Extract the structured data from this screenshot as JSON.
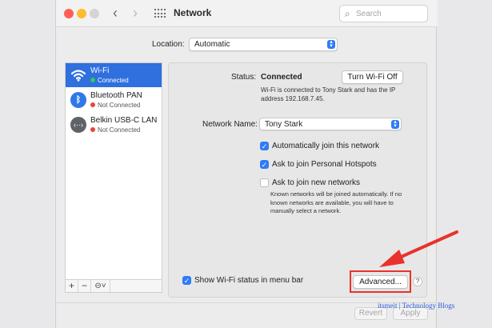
{
  "window": {
    "title": "Network"
  },
  "search": {
    "placeholder": "Search"
  },
  "location": {
    "label": "Location:",
    "value": "Automatic"
  },
  "services": [
    {
      "name": "Wi-Fi",
      "status": "Connected",
      "status_color": "#35c759",
      "icon": "wifi-icon",
      "selected": true
    },
    {
      "name": "Bluetooth PAN",
      "status": "Not Connected",
      "status_color": "#e5473c",
      "icon": "bluetooth-icon",
      "selected": false
    },
    {
      "name": "Belkin USB-C LAN",
      "status": "Not Connected",
      "status_color": "#e5473c",
      "icon": "ethernet-icon",
      "selected": false
    }
  ],
  "list_toolbar": {
    "add": "+",
    "remove": "−",
    "action": "⊖˅"
  },
  "detail": {
    "status_label": "Status:",
    "status_value": "Connected",
    "turn_off_button": "Turn Wi-Fi Off",
    "status_description": "Wi-Fi is connected to Tony Stark and has the IP address 192.168.7.45.",
    "network_name_label": "Network Name:",
    "network_name_value": "Tony Stark",
    "options": [
      {
        "label": "Automatically join this network",
        "checked": true
      },
      {
        "label": "Ask to join Personal Hotspots",
        "checked": true
      },
      {
        "label": "Ask to join new networks",
        "checked": false
      }
    ],
    "info_text": "Known networks will be joined automatically. If no known networks are available, you will have to manually select a network.",
    "menu_bar_label": "Show Wi-Fi status in menu bar",
    "menu_bar_checked": true,
    "advanced_button": "Advanced...",
    "help": "?"
  },
  "footer": {
    "revert": "Revert",
    "apply": "Apply"
  },
  "annotation": {
    "highlight_color": "#e8322b"
  },
  "watermark": "itsmeit | Technology Blogs"
}
